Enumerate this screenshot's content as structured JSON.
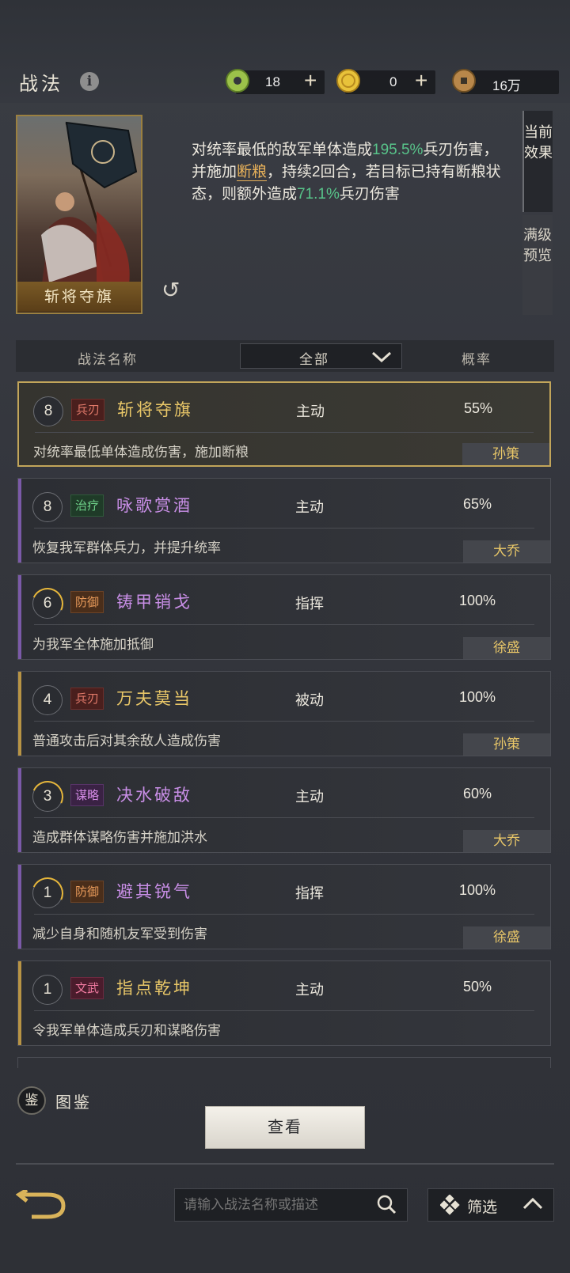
{
  "header": {
    "title": "战法",
    "currencies": [
      {
        "icon": "jade-coin-icon",
        "value": "18",
        "has_plus": true
      },
      {
        "icon": "gold-coin-icon",
        "value": "0",
        "has_plus": true
      },
      {
        "icon": "copper-coin-icon",
        "value": "16万",
        "has_plus": false
      }
    ]
  },
  "detail": {
    "card_name": "斩将夺旗",
    "desc_p1": "对统率最低的敌军单体造成",
    "desc_v1": "195.5%",
    "desc_p2": "兵刃伤害，并施加",
    "desc_kw": "断粮",
    "desc_p3": "，持续2回合，若目标已持有断粮状态，则额外造成",
    "desc_v2": "71.1%",
    "desc_p4": "兵刃伤害",
    "tab_current": "当前效果",
    "tab_full": "满级预览"
  },
  "table": {
    "col_name": "战法名称",
    "filter_value": "全部",
    "col_prob": "概率"
  },
  "skills": [
    {
      "level": "8",
      "tag": "兵刃",
      "name": "斩将夺旗",
      "type": "主动",
      "prob": "55%",
      "desc": "对统率最低单体造成伤害，施加断粮",
      "owner": "孙策"
    },
    {
      "level": "8",
      "tag": "治疗",
      "name": "咏歌赏酒",
      "type": "主动",
      "prob": "65%",
      "desc": "恢复我军群体兵力，并提升统率",
      "owner": "大乔"
    },
    {
      "level": "6",
      "tag": "防御",
      "name": "铸甲销戈",
      "type": "指挥",
      "prob": "100%",
      "desc": "为我军全体施加抵御",
      "owner": "徐盛"
    },
    {
      "level": "4",
      "tag": "兵刃",
      "name": "万夫莫当",
      "type": "被动",
      "prob": "100%",
      "desc": "普通攻击后对其余敌人造成伤害",
      "owner": "孙策"
    },
    {
      "level": "3",
      "tag": "谋略",
      "name": "决水破敌",
      "type": "主动",
      "prob": "60%",
      "desc": "造成群体谋略伤害并施加洪水",
      "owner": "大乔"
    },
    {
      "level": "1",
      "tag": "防御",
      "name": "避其锐气",
      "type": "指挥",
      "prob": "100%",
      "desc": "减少自身和随机友军受到伤害",
      "owner": "徐盛"
    },
    {
      "level": "1",
      "tag": "文武",
      "name": "指点乾坤",
      "type": "主动",
      "prob": "50%",
      "desc": "令我军单体造成兵刃和谋略伤害",
      "owner": ""
    }
  ],
  "bottom": {
    "codex_icon_char": "鉴",
    "codex_label": "图鉴",
    "view_button": "查看",
    "search_placeholder": "请输入战法名称或描述",
    "filter_label": "筛选"
  },
  "colors": {
    "accent_gold": "#e9c768",
    "value_green": "#58c48a",
    "keyword_orange": "#e9b25a"
  }
}
